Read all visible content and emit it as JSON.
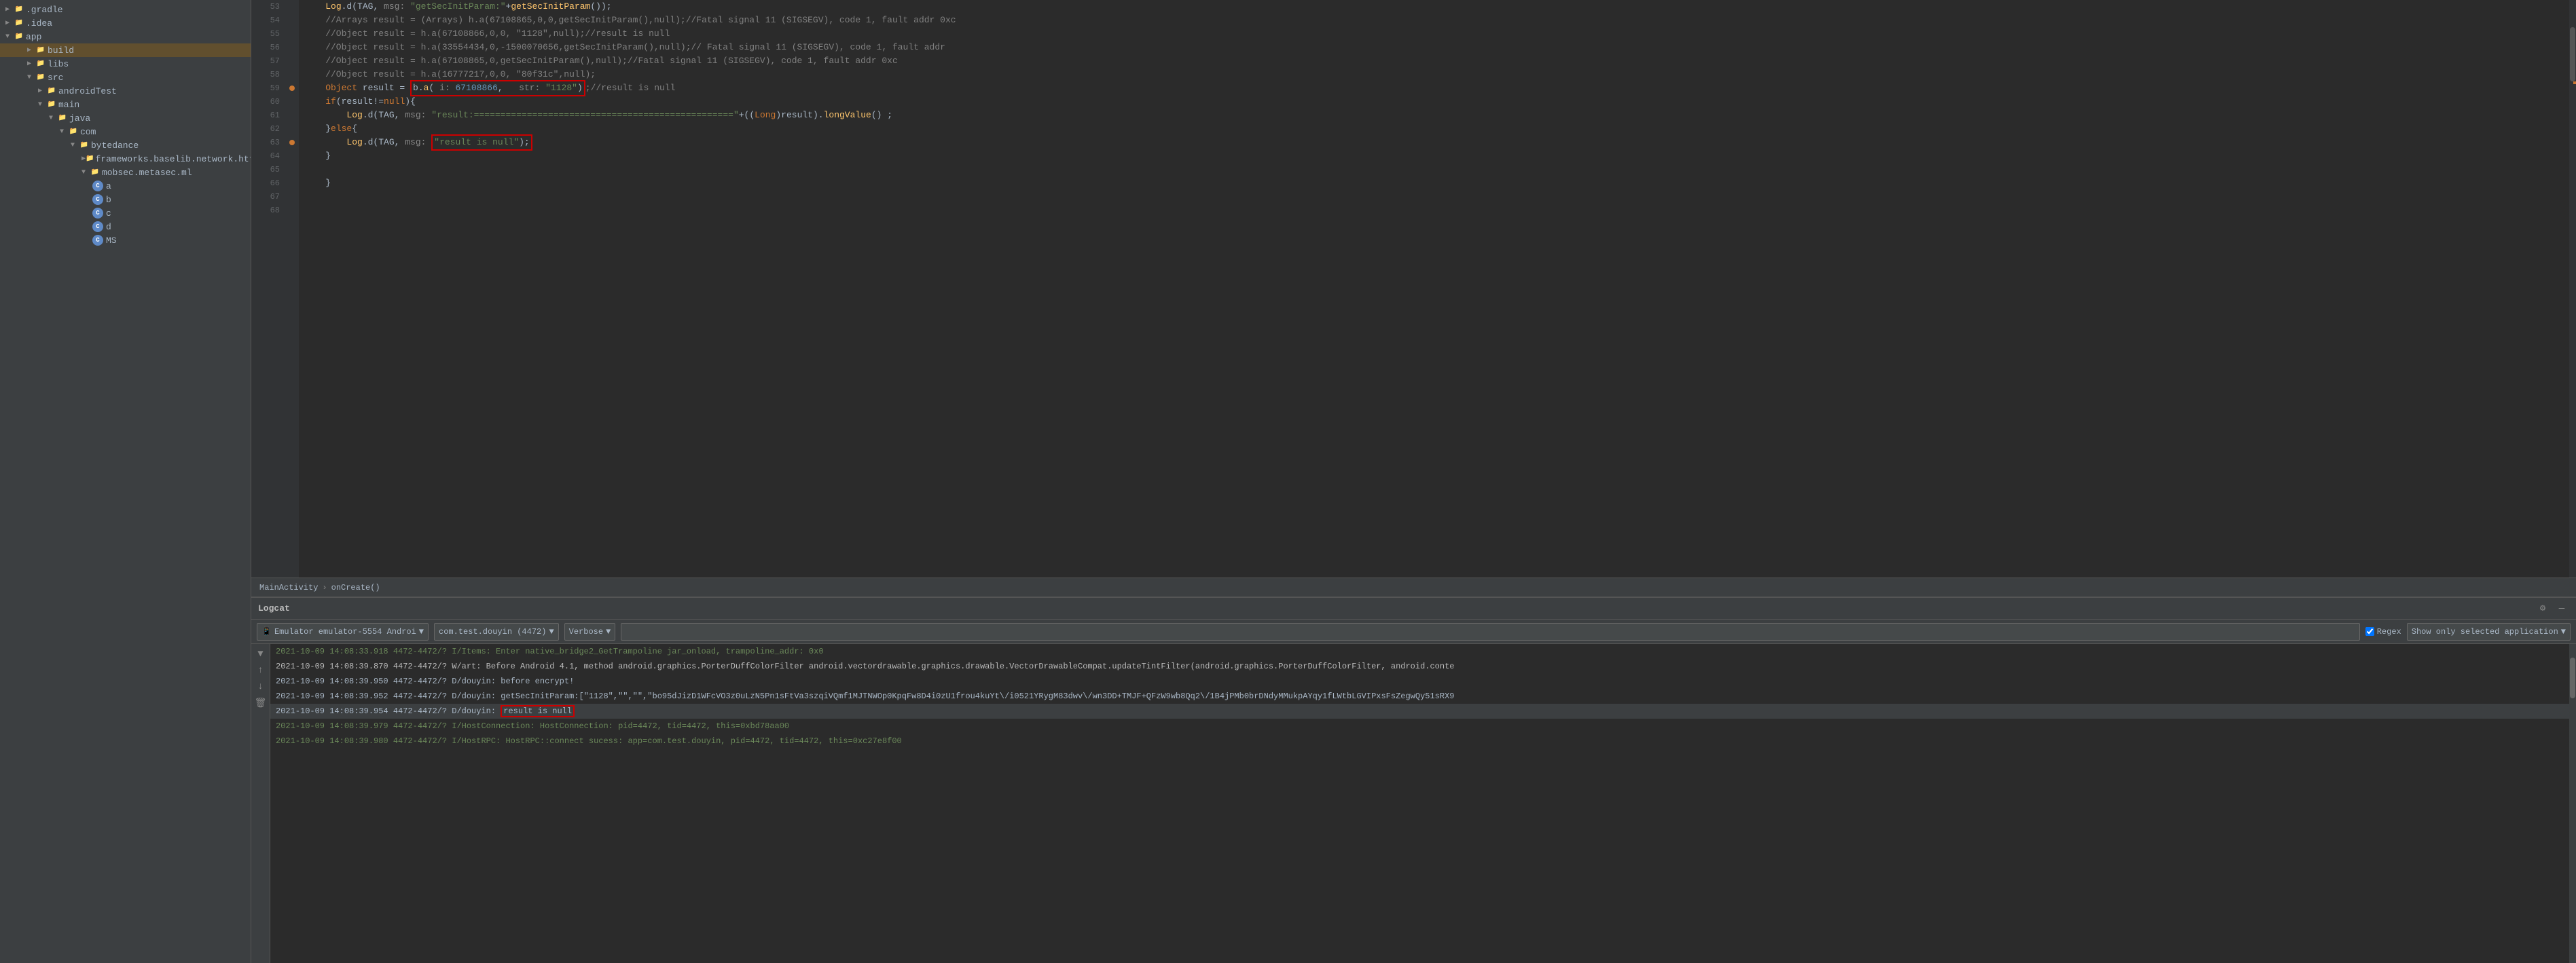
{
  "sidebar": {
    "items": [
      {
        "id": "gradle",
        "label": ".gradle",
        "indent": 1,
        "type": "folder",
        "state": "closed"
      },
      {
        "id": "idea",
        "label": ".idea",
        "indent": 1,
        "type": "folder",
        "state": "closed"
      },
      {
        "id": "app",
        "label": "app",
        "indent": 1,
        "type": "folder",
        "state": "open"
      },
      {
        "id": "build",
        "label": "build",
        "indent": 3,
        "type": "folder-special",
        "state": "closed"
      },
      {
        "id": "libs",
        "label": "libs",
        "indent": 3,
        "type": "folder",
        "state": "closed"
      },
      {
        "id": "src",
        "label": "src",
        "indent": 3,
        "type": "folder",
        "state": "open"
      },
      {
        "id": "androidTest",
        "label": "androidTest",
        "indent": 4,
        "type": "folder",
        "state": "closed"
      },
      {
        "id": "main",
        "label": "main",
        "indent": 4,
        "type": "folder",
        "state": "open"
      },
      {
        "id": "java",
        "label": "java",
        "indent": 5,
        "type": "folder",
        "state": "open"
      },
      {
        "id": "com",
        "label": "com",
        "indent": 6,
        "type": "folder",
        "state": "open"
      },
      {
        "id": "bytedance",
        "label": "bytedance",
        "indent": 7,
        "type": "folder",
        "state": "open"
      },
      {
        "id": "frameworks",
        "label": "frameworks.baselib.network.htt",
        "indent": 8,
        "type": "folder",
        "state": "closed"
      },
      {
        "id": "mobsec",
        "label": "mobsec.metasec.ml",
        "indent": 8,
        "type": "folder",
        "state": "open"
      },
      {
        "id": "a",
        "label": "a",
        "indent": 9,
        "type": "java-class"
      },
      {
        "id": "b",
        "label": "b",
        "indent": 9,
        "type": "java-class"
      },
      {
        "id": "c",
        "label": "c",
        "indent": 9,
        "type": "java-class"
      },
      {
        "id": "d",
        "label": "d",
        "indent": 9,
        "type": "java-class"
      },
      {
        "id": "MS",
        "label": "MS",
        "indent": 9,
        "type": "java-class"
      }
    ]
  },
  "editor": {
    "lines": [
      {
        "num": 53,
        "content": "    Log.d(TAG, msg: \"getSecInitParam:\"+getSecInitParam());"
      },
      {
        "num": 54,
        "content": "    //Arrays result = (Arrays) h.a(67108865,0,0,getSecInitParam(),null);//Fatal signal 11 (SIGSEGV), code 1, fault addr 0xc"
      },
      {
        "num": 55,
        "content": "    //Object result = h.a(67108866,0,0, \"1128\",null);//result is null"
      },
      {
        "num": 56,
        "content": "    //Object result = h.a(33554434,0,-1500070656,getSecInitParam(),null);// Fatal signal 11 (SIGSEGV), code 1, fault addr"
      },
      {
        "num": 57,
        "content": "    //Object result = h.a(67108865,0,getSecInitParam(),null);//Fatal signal 11 (SIGSEGV), code 1, fault addr 0xc"
      },
      {
        "num": 58,
        "content": "    //Object result = h.a(16777217,0,0, \"80f31c\",null);"
      },
      {
        "num": 59,
        "content": "    Object result = b.a( i: 67108866,   str: \"1128\");//result is null",
        "highlight_box": true
      },
      {
        "num": 60,
        "content": "    if(result!=null){"
      },
      {
        "num": 61,
        "content": "        Log.d(TAG, msg: \"result:=================================================\"+((Long)result).longValue();"
      },
      {
        "num": 62,
        "content": "    }else{"
      },
      {
        "num": 63,
        "content": "        Log.d(TAG, msg: \"result is null\");",
        "result_null_box": true
      },
      {
        "num": 64,
        "content": "    }"
      },
      {
        "num": 65,
        "content": ""
      },
      {
        "num": 66,
        "content": "    }"
      },
      {
        "num": 67,
        "content": ""
      },
      {
        "num": 68,
        "content": ""
      }
    ]
  },
  "breadcrumb": {
    "path": "MainActivity",
    "arrow": "›",
    "method": "onCreate()"
  },
  "logcat": {
    "title": "Logcat",
    "device": "Emulator emulator-5554 Androi",
    "process": "com.test.douyin (4472)",
    "level": "Verbose",
    "search_placeholder": "",
    "regex_label": "Regex",
    "regex_checked": true,
    "show_only_label": "Show only selected application",
    "settings_icon": "⚙",
    "minimize_icon": "—",
    "log_lines": [
      {
        "text": "2021-10-09 14:08:33.918 4472-4472/? I/Items: Enter native_bridge2_GetTrampoline jar_onload, trampoline_addr: 0x0",
        "type": "info"
      },
      {
        "text": "2021-10-09 14:08:39.870 4472-4472/? W/art: Before Android 4.1, method android.graphics.PorterDuffColorFilter android.vectordrawable.graphics.drawable.VectorDrawableCompat.updateTintFilter(android.graphics.PorterDuffColorFilter, android.conte",
        "type": "warn"
      },
      {
        "text": "2021-10-09 14:08:39.950 4472-4472/? D/douyin: before encrypt!",
        "type": "debug"
      },
      {
        "text": "2021-10-09 14:08:39.952 4472-4472/? D/douyin: getSecInitParam:[\"1128\",\"\",\"\",\"bo95dJizD1WFcVO3z0uLzN5Pn1sFtVa3szqiVQmf1MJTNWOp0KpqFw8D4i0zU1frou4kuYt\\/i0521YRygM83dwv\\/wn3DD+TMJF+QFzW9wb8Qq2\\/1B4jPMb0brDNdyMMukpAYqy1fLWtbLGVIPxsFsZegwQy51sRX9",
        "type": "debug"
      },
      {
        "text": "2021-10-09 14:08:39.954 4472-4472/? D/douyin: result is null",
        "type": "debug",
        "highlighted": true
      },
      {
        "text": "2021-10-09 14:08:39.979 4472-4472/? I/HostConnection: HostConnection: pid=4472, tid=4472, this=0xbd78aa00",
        "type": "info"
      },
      {
        "text": "2021-10-09 14:08:39.980 4472-4472/? I/HostRPC: HostRPC::connect sucess: app=com.test.douyin, pid=4472, tid=4472, this=0xc27e8f00",
        "type": "info"
      }
    ],
    "left_icons": [
      "▼",
      "↑",
      "↓",
      "🗑"
    ]
  }
}
